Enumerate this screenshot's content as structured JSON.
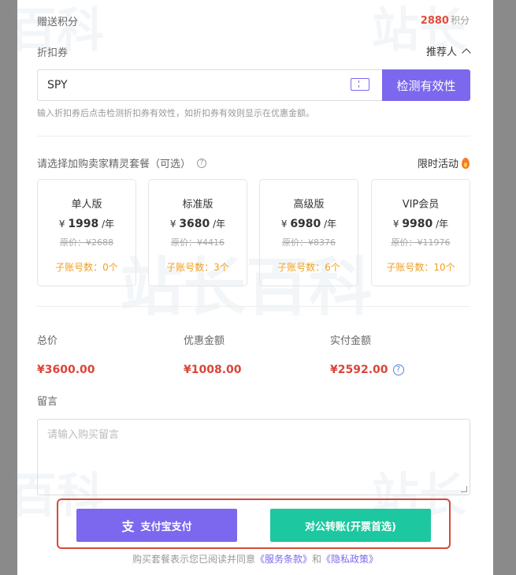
{
  "points": {
    "label": "赠送积分",
    "value": "2880",
    "unit": "积分"
  },
  "coupon": {
    "label": "折扣券",
    "value": "SPY",
    "check_button": "检测有效性",
    "hint": "输入折扣券后点击检测折扣券有效性，如折扣券有效则显示在优惠金额。"
  },
  "referrer": {
    "label": "推荐人"
  },
  "packages": {
    "title": "请选择加购卖家精灵套餐（可选）",
    "limited": "限时活动",
    "currency": "¥",
    "per": "/年",
    "items": [
      {
        "name": "单人版",
        "price": "1998",
        "original": "原价：¥2688",
        "sub": "子账号数：0个"
      },
      {
        "name": "标准版",
        "price": "3680",
        "original": "原价：¥4416",
        "sub": "子账号数：3个"
      },
      {
        "name": "高级版",
        "price": "6980",
        "original": "原价：¥8376",
        "sub": "子账号数：6个"
      },
      {
        "name": "VIP会员",
        "price": "9980",
        "original": "原价：¥11976",
        "sub": "子账号数：10个"
      }
    ]
  },
  "summary": {
    "total_label": "总价",
    "total": "¥3600.00",
    "discount_label": "优惠金额",
    "discount": "¥1008.00",
    "paid_label": "实付金额",
    "paid": "¥2592.00"
  },
  "message": {
    "label": "留言",
    "placeholder": "请输入购买留言"
  },
  "pay": {
    "alipay_icon": "支",
    "alipay": "支付宝支付",
    "transfer": "对公转账(开票首选)"
  },
  "agreement": {
    "prefix": "购买套餐表示您已阅读并同意",
    "terms": "《服务条款》",
    "and": "和",
    "privacy": "《隐私政策》"
  },
  "watermark": {
    "part1": "站长",
    "part2": "百科"
  },
  "colors": {
    "accent": "#7b68ee",
    "price": "#d9453a",
    "transfer": "#1dc7a0",
    "highlight": "#d64a37"
  }
}
